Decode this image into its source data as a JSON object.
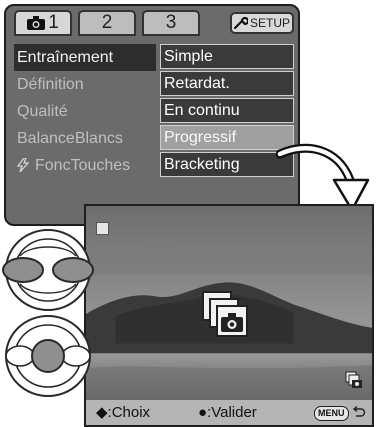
{
  "tabs": [
    {
      "label": "1",
      "active": true
    },
    {
      "label": "2",
      "active": false
    },
    {
      "label": "3",
      "active": false
    }
  ],
  "setup_label": "SETUP",
  "menu": [
    {
      "label": "Entraînement",
      "option": "Simple",
      "selected": true,
      "highlighted": false
    },
    {
      "label": "Définition",
      "option": "Retardat.",
      "selected": false,
      "highlighted": false
    },
    {
      "label": "Qualité",
      "option": "En continu",
      "selected": false,
      "highlighted": false
    },
    {
      "label": "BalanceBlancs",
      "option": "Progressif",
      "selected": false,
      "highlighted": true
    },
    {
      "label": "FoncTouches",
      "option": "Bracketing",
      "selected": false,
      "highlighted": false,
      "icon": "flash-icon"
    }
  ],
  "status": {
    "choose": "◆:Choix",
    "validate": "●:Valider",
    "menu_key": "MENU"
  },
  "colors": {
    "menu_bg": "#6b6b6b",
    "selected_bg": "#2d2d2d",
    "option_bg": "#3a3a3a",
    "highlight_bg": "#a0a0a0",
    "status_bg": "#b5b5b5"
  }
}
